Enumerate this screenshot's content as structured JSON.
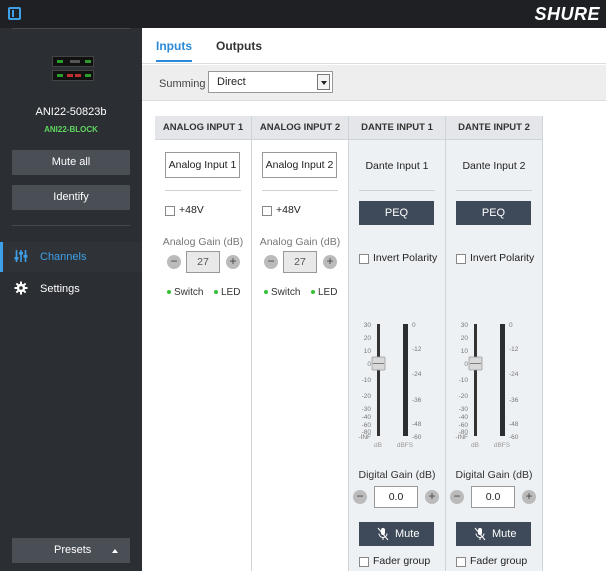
{
  "brand": "SHURE",
  "sidebar": {
    "device_name": "ANI22-50823b",
    "device_subtitle": "ANI22-BLOCK",
    "mute_all_label": "Mute all",
    "identify_label": "Identify",
    "nav": [
      {
        "label": "Channels",
        "active": true,
        "icon": "sliders-icon"
      },
      {
        "label": "Settings",
        "active": false,
        "icon": "gear-icon"
      }
    ],
    "presets_label": "Presets"
  },
  "tabs": [
    {
      "label": "Inputs",
      "active": true
    },
    {
      "label": "Outputs",
      "active": false
    }
  ],
  "summing": {
    "label": "Summing",
    "value": "Direct"
  },
  "channels": {
    "analog1": {
      "header": "ANALOG INPUT 1",
      "name": "Analog Input 1",
      "phantom_label": "+48V",
      "phantom_checked": false,
      "gain_label": "Analog Gain (dB)",
      "gain_value": "27",
      "legend_switch": "Switch",
      "legend_led": "LED"
    },
    "analog2": {
      "header": "ANALOG INPUT 2",
      "name": "Analog Input 2",
      "phantom_label": "+48V",
      "phantom_checked": false,
      "gain_label": "Analog Gain (dB)",
      "gain_value": "27",
      "legend_switch": "Switch",
      "legend_led": "LED"
    },
    "dante1": {
      "header": "DANTE INPUT 1",
      "name": "Dante Input 1",
      "peq_label": "PEQ",
      "invert_label": "Invert Polarity",
      "invert_checked": false,
      "digital_gain_label": "Digital Gain (dB)",
      "digital_gain_value": "0.0",
      "mute_label": "Mute",
      "fader_group_label": "Fader group",
      "fader_group_checked": false
    },
    "dante2": {
      "header": "DANTE INPUT 2",
      "name": "Dante Input 2",
      "peq_label": "PEQ",
      "invert_label": "Invert Polarity",
      "invert_checked": false,
      "digital_gain_label": "Digital Gain (dB)",
      "digital_gain_value": "0.0",
      "mute_label": "Mute",
      "fader_group_label": "Fader group",
      "fader_group_checked": false
    }
  },
  "meter": {
    "fader_scale": [
      "30",
      "20",
      "10",
      "0",
      "-10",
      "-20",
      "-30",
      "-40",
      "-60",
      "-80",
      "-INF"
    ],
    "fader_unit": "dB",
    "meter_scale": [
      "0",
      "-12",
      "-24",
      "-36",
      "-48",
      "-60"
    ],
    "meter_unit": "dBFS",
    "fader_value_db": 0
  },
  "colors": {
    "accent": "#2a89d8",
    "status_green": "#35c135",
    "button_dark": "#3e4a59",
    "sidebar_bg": "#2b2e33"
  }
}
